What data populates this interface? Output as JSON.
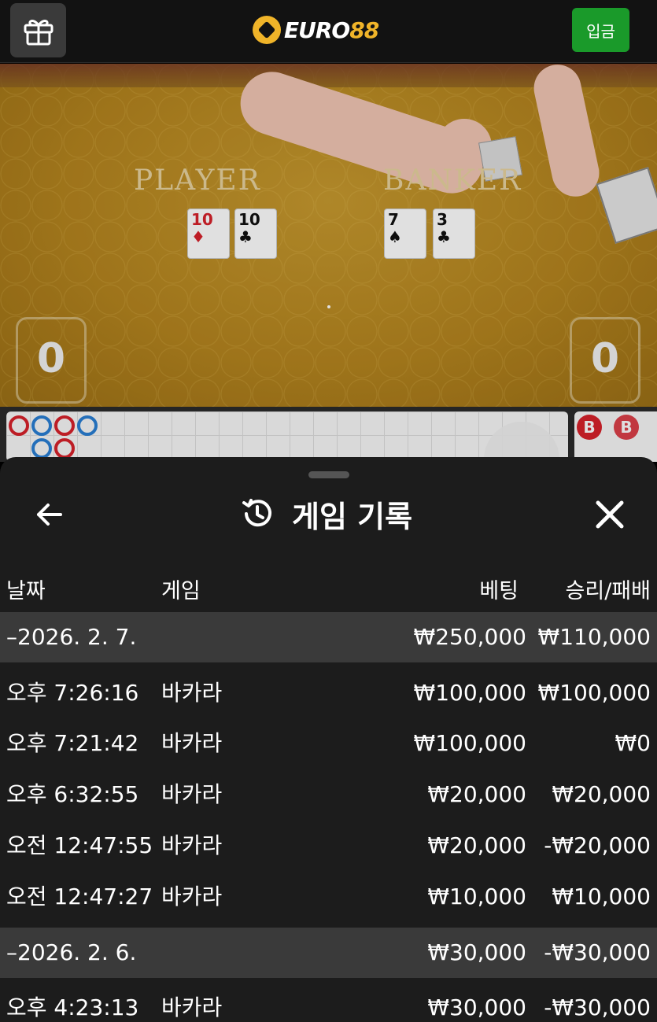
{
  "header": {
    "logo_euro": "EURO",
    "logo_num": "88",
    "deposit_label": "입금"
  },
  "table": {
    "player_label": "PLAYER",
    "banker_label": "BANKER",
    "player_cards": [
      {
        "rank": "10",
        "suit": "♦",
        "color": "red"
      },
      {
        "rank": "10",
        "suit": "♣",
        "color": "black"
      }
    ],
    "banker_cards": [
      {
        "rank": "7",
        "suit": "♠",
        "color": "black"
      },
      {
        "rank": "3",
        "suit": "♣",
        "color": "black"
      }
    ],
    "player_score": "0",
    "banker_score": "0"
  },
  "roadmap": {
    "bead_b": "B",
    "colors": {
      "banker": "#d8212b",
      "player": "#2a7fd4"
    }
  },
  "history": {
    "title": "게임 기록",
    "columns": {
      "date": "날짜",
      "game": "게임",
      "bet": "베팅",
      "winloss": "승리/패배"
    },
    "groups": [
      {
        "date": "–2026. 2. 7.",
        "bet_total": "₩250,000",
        "win_total": "₩110,000",
        "rows": [
          {
            "time": "오후 7:26:16",
            "game": "바카라",
            "bet": "₩100,000",
            "result": "₩100,000"
          },
          {
            "time": "오후 7:21:42",
            "game": "바카라",
            "bet": "₩100,000",
            "result": "₩0"
          },
          {
            "time": "오후 6:32:55",
            "game": "바카라",
            "bet": "₩20,000",
            "result": "₩20,000"
          },
          {
            "time": "오전 12:47:55",
            "game": "바카라",
            "bet": "₩20,000",
            "result": "-₩20,000"
          },
          {
            "time": "오전 12:47:27",
            "game": "바카라",
            "bet": "₩10,000",
            "result": "₩10,000"
          }
        ]
      },
      {
        "date": "–2026. 2. 6.",
        "bet_total": "₩30,000",
        "win_total": "-₩30,000",
        "rows": [
          {
            "time": "오후 4:23:13",
            "game": "바카라",
            "bet": "₩30,000",
            "result": "-₩30,000"
          }
        ]
      }
    ]
  }
}
